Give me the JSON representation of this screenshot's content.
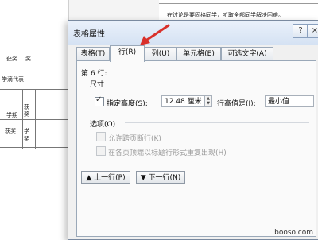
{
  "document": {
    "top_text": "在讨论是要固格同学，听取全部同学解决困难。",
    "cells": [
      "获奖",
      "奖",
      "学滴代表",
      "获",
      "奖",
      "学期",
      "获奖",
      "学",
      "奖"
    ]
  },
  "dialog": {
    "title": "表格属性",
    "help": "?",
    "close": "×",
    "tabs": [
      "表格(T)",
      "行(R)",
      "列(U)",
      "单元格(E)",
      "可选文字(A)"
    ],
    "row_heading": "第 6 行:",
    "size_label": "尺寸",
    "specify_height_label": "指定高度(S):",
    "height_value": "12.48 厘米",
    "row_height_is_label": "行高值是(I):",
    "row_height_is_value": "最小值",
    "options_label": "选项(O)",
    "allow_break_label": "允许跨页断行(K)",
    "repeat_header_label": "在各页顶端以标题行形式重复出现(H)",
    "prev_row_button": "▲ 上一行(P)",
    "next_row_button": "▼ 下一行(N)"
  },
  "watermark": "booso.com",
  "colors": {
    "arrow": "#d9302a",
    "dialog_title_bg": "#dce7f5"
  }
}
